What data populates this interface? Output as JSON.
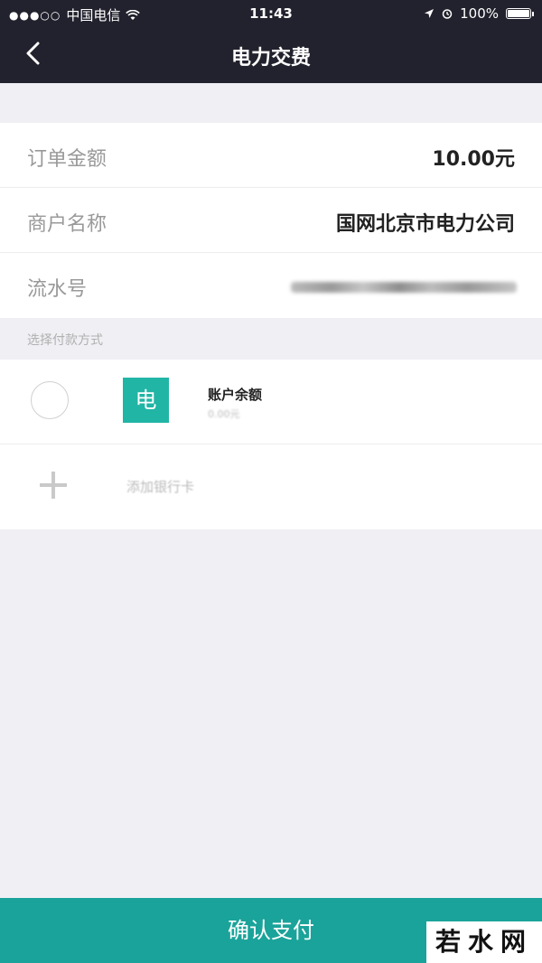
{
  "status_bar": {
    "carrier": "中国电信",
    "time": "11:43",
    "battery": "100%"
  },
  "nav": {
    "title": "电力交费"
  },
  "order": {
    "amount_label": "订单金额",
    "amount_value": "10.00元",
    "merchant_label": "商户名称",
    "merchant_value": "国网北京市电力公司",
    "serial_label": "流水号"
  },
  "payment": {
    "section_label": "选择付款方式",
    "methods": [
      {
        "title": "账户余额",
        "icon_char": "电",
        "subtitle": "0.00元"
      }
    ],
    "add_card_label": "添加银行卡"
  },
  "footer": {
    "confirm_label": "确认支付"
  },
  "watermark": "若水网",
  "colors": {
    "header_bg": "#22222e",
    "accent": "#1aa39a",
    "icon_bg": "#21b5a5"
  }
}
